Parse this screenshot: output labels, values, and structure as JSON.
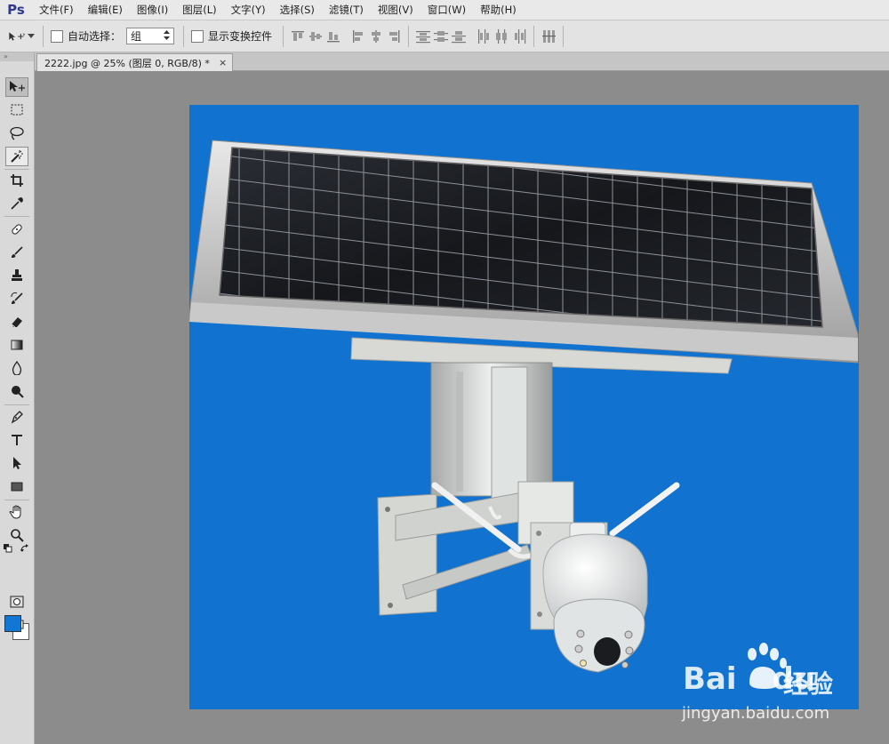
{
  "app": {
    "logo": "Ps"
  },
  "menu": [
    {
      "label": "文件(F)"
    },
    {
      "label": "编辑(E)"
    },
    {
      "label": "图像(I)"
    },
    {
      "label": "图层(L)"
    },
    {
      "label": "文字(Y)"
    },
    {
      "label": "选择(S)"
    },
    {
      "label": "滤镜(T)"
    },
    {
      "label": "视图(V)"
    },
    {
      "label": "窗口(W)"
    },
    {
      "label": "帮助(H)"
    }
  ],
  "options": {
    "auto_select_label": "自动选择：",
    "auto_select_value": "组",
    "show_transform_label": "显示变换控件"
  },
  "tools": {
    "foreground_color": "#1176d4",
    "background_color": "#ffffff"
  },
  "document": {
    "tab_title": "2222.jpg @ 25% (图层 0, RGB/8) *",
    "tab_close": "×",
    "canvas_color": "#1173cf"
  },
  "watermark": {
    "brand": "Bai",
    "brand_suffix": "du",
    "brand_cn": "经验",
    "url": "jingyan.baidu.com"
  }
}
